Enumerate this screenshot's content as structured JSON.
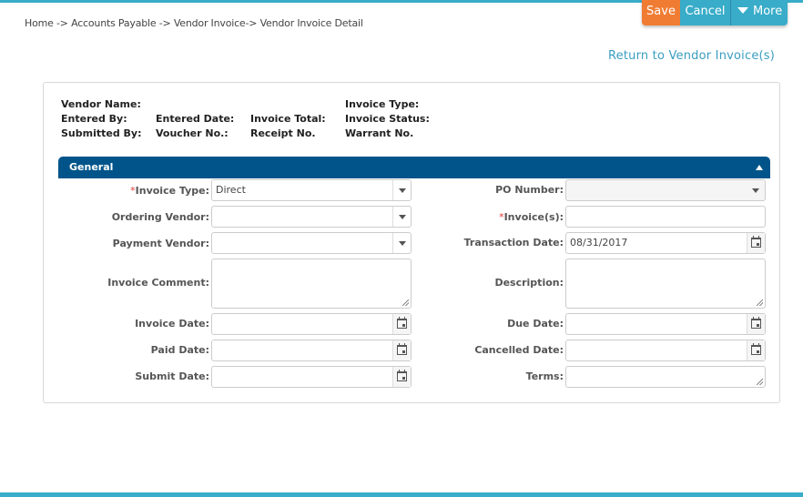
{
  "breadcrumb": "Home -> Accounts Payable -> Vendor Invoice-> Vendor Invoice Detail",
  "toolbar": {
    "save": "Save",
    "cancel": "Cancel",
    "more": "More"
  },
  "return_link": "Return to Vendor Invoice(s)",
  "summary": {
    "vendor_name": "Vendor Name:",
    "invoice_type": "Invoice Type:",
    "entered_by": "Entered By:",
    "entered_date": "Entered Date:",
    "invoice_total": "Invoice Total:",
    "invoice_status": "Invoice Status:",
    "submitted_by": "Submitted By:",
    "voucher_no": "Voucher No.:",
    "receipt_no": "Receipt No.",
    "warrant_no": "Warrant No."
  },
  "section": {
    "title": "General"
  },
  "form": {
    "required_marker": "*",
    "invoice_type": {
      "label": "Invoice Type:",
      "value": "Direct"
    },
    "ordering_vendor": {
      "label": "Ordering Vendor:",
      "value": ""
    },
    "payment_vendor": {
      "label": "Payment Vendor:",
      "value": ""
    },
    "invoice_comment": {
      "label": "Invoice Comment:",
      "value": ""
    },
    "invoice_date": {
      "label": "Invoice Date:",
      "value": ""
    },
    "paid_date": {
      "label": "Paid Date:",
      "value": ""
    },
    "submit_date": {
      "label": "Submit Date:",
      "value": ""
    },
    "po_number": {
      "label": "PO Number:",
      "value": ""
    },
    "invoices": {
      "label": "Invoice(s):",
      "value": ""
    },
    "transaction_date": {
      "label": "Transaction Date:",
      "value": "08/31/2017"
    },
    "description": {
      "label": "Description:",
      "value": ""
    },
    "due_date": {
      "label": "Due Date:",
      "value": ""
    },
    "cancelled_date": {
      "label": "Cancelled Date:",
      "value": ""
    },
    "terms": {
      "label": "Terms:",
      "value": ""
    }
  },
  "colors": {
    "accent": "#38acc9",
    "save": "#f07c33",
    "section_header": "#00548a",
    "link": "#3a9ec0",
    "required": "#e03a3a"
  }
}
